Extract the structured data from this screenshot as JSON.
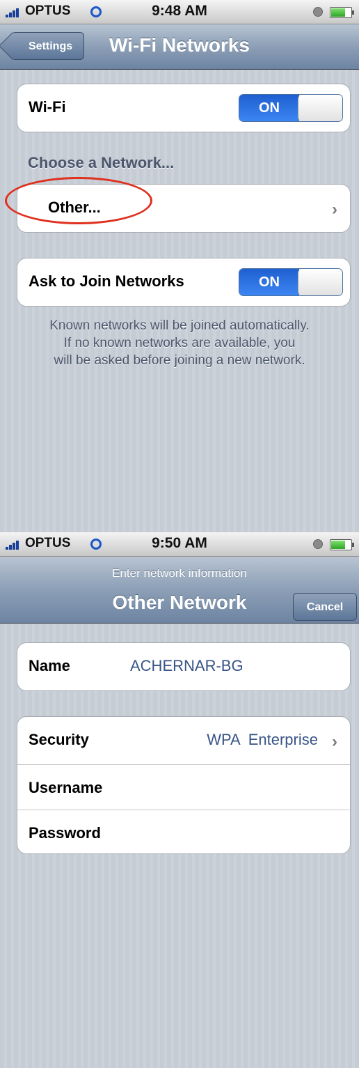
{
  "screen1": {
    "status": {
      "carrier": "OPTUS",
      "time": "9:48 AM"
    },
    "nav": {
      "back_label": "Settings",
      "title": "Wi-Fi Networks"
    },
    "wifi": {
      "label": "Wi-Fi",
      "toggle": "ON"
    },
    "section_header": "Choose a Network...",
    "other": {
      "label": "Other...",
      "chevron": "›"
    },
    "ask_join": {
      "label": "Ask to Join Networks",
      "toggle": "ON"
    },
    "footer_lines": [
      "Known networks will be joined automatically.",
      "If no known networks are available, you",
      "will be asked before joining a new network."
    ],
    "highlight_color": "#e0301e"
  },
  "screen2": {
    "status": {
      "carrier": "OPTUS",
      "time": "9:50 AM"
    },
    "nav": {
      "prompt": "Enter network information",
      "title": "Other Network",
      "cancel_label": "Cancel"
    },
    "name": {
      "label": "Name",
      "value": "ACHERNAR-BG"
    },
    "security": {
      "label": "Security",
      "value": "WPA  Enterprise",
      "chevron": "›"
    },
    "username": {
      "label": "Username"
    },
    "password": {
      "label": "Password"
    }
  },
  "colors": {
    "nav_blue": "#6d84a2",
    "toggle_blue": "#2e74e3",
    "value_blue": "#385487",
    "background": "#c5ccd4"
  }
}
